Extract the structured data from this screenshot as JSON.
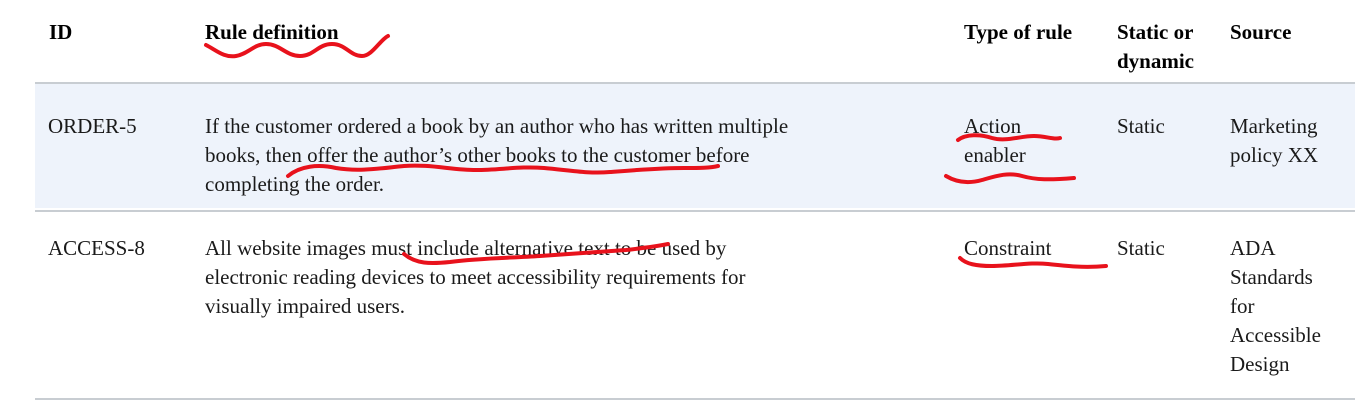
{
  "headers": {
    "id": "ID",
    "rule_definition": "Rule definition",
    "type_of_rule": "Type of rule",
    "static_or_dynamic_line1": "Static or",
    "static_or_dynamic_line2": "dynamic",
    "source": "Source"
  },
  "rows": [
    {
      "id": "ORDER-5",
      "definition_lines": [
        "If the customer ordered a book by an author who has written multiple",
        "books, then offer the author’s other books to the customer before",
        "completing the order."
      ],
      "type_lines": [
        "Action",
        "enabler"
      ],
      "static_or_dynamic": "Static",
      "source_lines": [
        "Marketing",
        "policy XX"
      ]
    },
    {
      "id": "ACCESS-8",
      "definition_lines": [
        "All website images must include alternative text to be used by",
        "electronic reading devices to meet accessibility requirements for",
        "visually impaired users."
      ],
      "type_lines": [
        "Constraint"
      ],
      "static_or_dynamic": "Static",
      "source_lines": [
        "ADA",
        "Standards",
        "for",
        "Accessible",
        "Design"
      ]
    }
  ],
  "colors": {
    "row_highlight": "#eef3fb",
    "divider": "#c8cdd2",
    "annotation_ink": "#e8121c"
  }
}
